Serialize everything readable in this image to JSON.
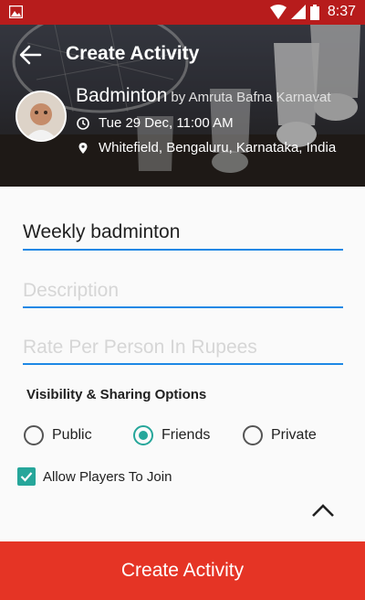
{
  "status_bar": {
    "time": "8:37",
    "icons": [
      "image-icon",
      "wifi-icon",
      "signal-icon",
      "battery-icon"
    ]
  },
  "header": {
    "title": "Create Activity",
    "sport": "Badminton",
    "by": "by Amruta Bafna Karnavat",
    "datetime": "Tue 29 Dec, 11:00 AM",
    "location": "Whitefield, Bengaluru, Karnataka, India"
  },
  "form": {
    "name_value": "Weekly badminton",
    "description_placeholder": "Description",
    "rate_placeholder": "Rate Per Person In Rupees",
    "visibility_heading": "Visibility & Sharing Options",
    "visibility_options": [
      {
        "label": "Public",
        "selected": false
      },
      {
        "label": "Friends",
        "selected": true
      },
      {
        "label": "Private",
        "selected": false
      }
    ],
    "allow_players_label": "Allow Players To Join",
    "allow_players_checked": true
  },
  "footer": {
    "create_label": "Create Activity"
  },
  "colors": {
    "status_bar": "#b71c1c",
    "accent_teal": "#26a69a",
    "underline_blue": "#1e88e5",
    "button_red": "#e53425"
  }
}
